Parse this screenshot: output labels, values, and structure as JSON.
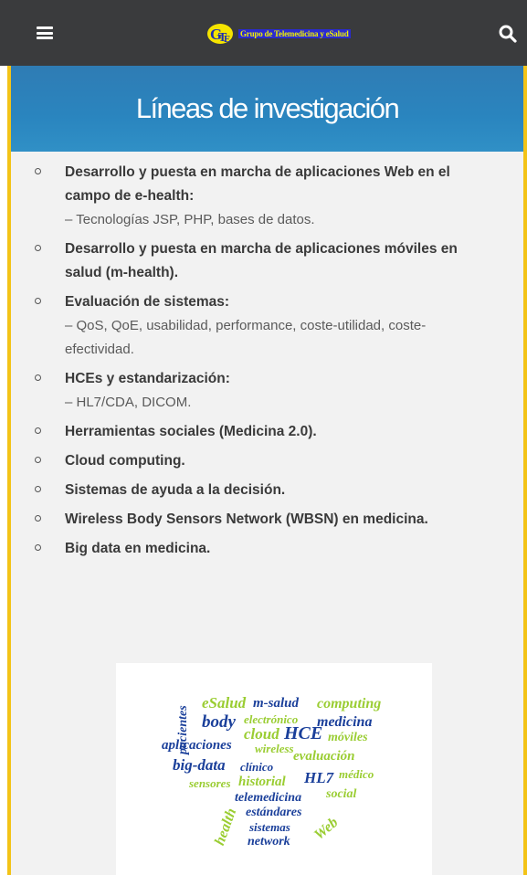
{
  "header": {
    "logo_text": "Grupo de Telemedicina y eSalud",
    "menu_icon": "hamburger-icon",
    "search_icon": "search-icon"
  },
  "page": {
    "title": "Líneas de investigación"
  },
  "research_lines": [
    {
      "title": "Desarrollo y puesta en marcha de aplicaciones Web en el campo de e-health:",
      "sub": "– Tecnologías JSP, PHP, bases de datos."
    },
    {
      "title": "Desarrollo y puesta en marcha de aplicaciones móviles en salud (m-health).",
      "sub": ""
    },
    {
      "title": "Evaluación de sistemas:",
      "sub": "– QoS, QoE, usabilidad, performance, coste-utilidad, coste-efectividad."
    },
    {
      "title": "HCEs y estandarización:",
      "sub": "– HL7/CDA, DICOM."
    },
    {
      "title": "Herramientas sociales (Medicina 2.0).",
      "sub": ""
    },
    {
      "title": "Cloud computing.",
      "sub": ""
    },
    {
      "title": "Sistemas de ayuda a la decisión.",
      "sub": ""
    },
    {
      "title": "Wireless Body Sensors Network (WBSN) en medicina.",
      "sub": ""
    },
    {
      "title": "Big data en medicina.",
      "sub": ""
    }
  ],
  "word_cloud": {
    "words": [
      {
        "text": "eSalud",
        "color": "#9acd32"
      },
      {
        "text": "m-salud",
        "color": "#1a3f9a"
      },
      {
        "text": "computing",
        "color": "#9acd32"
      },
      {
        "text": "pacientes",
        "color": "#1a3f9a"
      },
      {
        "text": "body",
        "color": "#1a3f9a"
      },
      {
        "text": "electrónico",
        "color": "#9acd32"
      },
      {
        "text": "medicina",
        "color": "#1a3f9a"
      },
      {
        "text": "cloud",
        "color": "#9acd32"
      },
      {
        "text": "HCE",
        "color": "#1a3f9a"
      },
      {
        "text": "móviles",
        "color": "#9acd32"
      },
      {
        "text": "aplicaciones",
        "color": "#1a3f9a"
      },
      {
        "text": "wireless",
        "color": "#9acd32"
      },
      {
        "text": "evaluación",
        "color": "#9acd32"
      },
      {
        "text": "big-data",
        "color": "#1a3f9a"
      },
      {
        "text": "clínico",
        "color": "#1a3f9a"
      },
      {
        "text": "HL7",
        "color": "#1a3f9a"
      },
      {
        "text": "médico",
        "color": "#9acd32"
      },
      {
        "text": "sensores",
        "color": "#9acd32"
      },
      {
        "text": "historial",
        "color": "#9acd32"
      },
      {
        "text": "social",
        "color": "#9acd32"
      },
      {
        "text": "telemedicina",
        "color": "#1a3f9a"
      },
      {
        "text": "health",
        "color": "#9acd32"
      },
      {
        "text": "estándares",
        "color": "#1a3f9a"
      },
      {
        "text": "Web",
        "color": "#9acd32"
      },
      {
        "text": "sistemas",
        "color": "#1a3f9a"
      },
      {
        "text": "network",
        "color": "#1a3f9a"
      }
    ]
  },
  "colors": {
    "topbar": "#3a3b3d",
    "banner": "#2f7cb4",
    "frame_accent": "#f3c317",
    "cloud_green": "#9acd32",
    "cloud_blue": "#1a3f9a"
  }
}
